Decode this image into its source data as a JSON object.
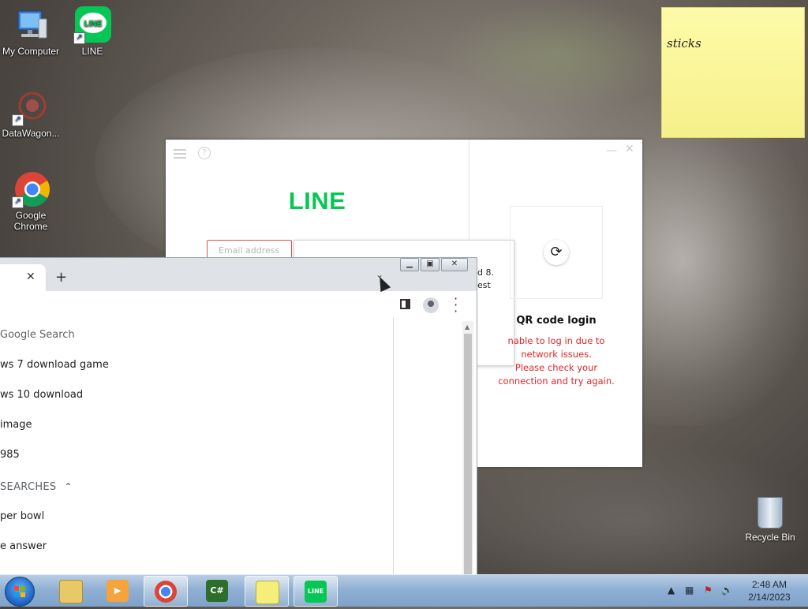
{
  "desktop": {
    "icons": [
      {
        "label": "My Computer"
      },
      {
        "label": "LINE"
      },
      {
        "label": "DataWagon..."
      },
      {
        "label": "Google Chrome"
      }
    ],
    "recycle_bin_label": "Recycle Bin"
  },
  "sticky_note": {
    "text": "sticks"
  },
  "line_window": {
    "logo": "LINE",
    "email_placeholder": "Email address",
    "popup_line1": "d 8.",
    "popup_line2": "est",
    "qr_title": "QR code login",
    "qr_error_lines": [
      "nable to log in due to",
      "network issues.",
      "Please check your",
      "connection and try again."
    ],
    "error_color": "#e0262a",
    "brand_color": "#06c755"
  },
  "chrome_window": {
    "dropdown_items": [
      "Google Search",
      "ws 7 download game",
      "ws 10 download",
      "image",
      "985"
    ],
    "section_heading": "SEARCHES",
    "trending_items": [
      "per bowl",
      "e answer"
    ]
  },
  "taskbar": {
    "time": "2:48 AM",
    "date": "2/14/2023"
  }
}
